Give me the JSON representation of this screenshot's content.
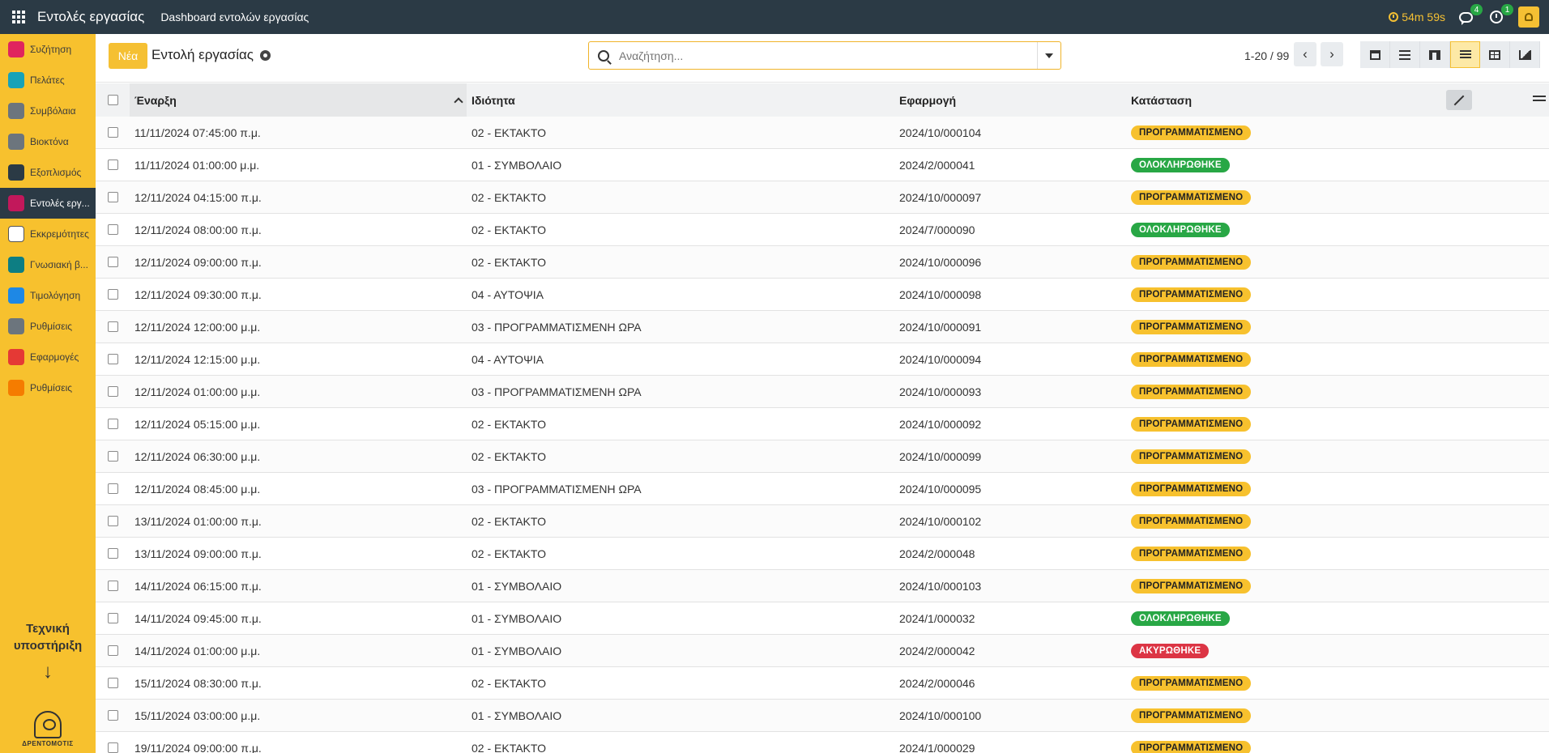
{
  "topbar": {
    "app_title": "Εντολές εργασίας",
    "menu_item": "Dashboard εντολών εργασίας",
    "timer": "54m 59s",
    "messages_count": "4",
    "activities_count": "1"
  },
  "sidebar": {
    "items": [
      {
        "label": "Συζήτηση",
        "icon": "chat-icon",
        "color": "#e0245e"
      },
      {
        "label": "Πελάτες",
        "icon": "customers-icon",
        "color": "#17a2b8"
      },
      {
        "label": "Συμβόλαια",
        "icon": "contracts-icon",
        "color": "#6c757d"
      },
      {
        "label": "Βιοκτόνα",
        "icon": "biocides-icon",
        "color": "#6c757d"
      },
      {
        "label": "Εξοπλισμός",
        "icon": "equipment-icon",
        "color": "#2b3a45"
      },
      {
        "label": "Εντολές εργ...",
        "icon": "work-orders-icon",
        "color": "#c2185b"
      },
      {
        "label": "Εκκρεμότητες",
        "icon": "tasks-icon",
        "color": "#ffffff"
      },
      {
        "label": "Γνωσιακή β...",
        "icon": "knowledge-icon",
        "color": "#0d7e83"
      },
      {
        "label": "Τιμολόγηση",
        "icon": "invoicing-icon",
        "color": "#1e88e5"
      },
      {
        "label": "Ρυθμίσεις",
        "icon": "settings-icon",
        "color": "#6c757d"
      },
      {
        "label": "Εφαρμογές",
        "icon": "apps-icon",
        "color": "#e53935"
      },
      {
        "label": "Ρυθμίσεις",
        "icon": "settings-alt-icon",
        "color": "#f57c00"
      }
    ],
    "active_index": 5,
    "support_line1": "Τεχνική",
    "support_line2": "υποστήριξη",
    "support_arrow": "↓",
    "logo_text": "ΔΡΕΝΤΟΜΟΤΙΣ"
  },
  "control": {
    "new_label": "Νέα",
    "title": "Εντολή εργασίας",
    "search_placeholder": "Αναζήτηση...",
    "pager": "1-20 / 99",
    "prev": "‹",
    "next": "›"
  },
  "table": {
    "headers": {
      "start": "Έναρξη",
      "priority": "Ιδιότητα",
      "application": "Εφαρμογή",
      "status": "Κατάσταση"
    },
    "rows": [
      {
        "start": "11/11/2024 07:45:00 π.μ.",
        "priority": "02 - ΕΚΤΑΚΤΟ",
        "application": "2024/10/000104",
        "status": "ΠΡΟΓΡΑΜΜΑΤΙΣΜΕΝΟ",
        "status_kind": "yellow"
      },
      {
        "start": "11/11/2024 01:00:00 μ.μ.",
        "priority": "01 - ΣΥΜΒΟΛΑΙΟ",
        "application": "2024/2/000041",
        "status": "ΟΛΟΚΛΗΡΩΘΗΚΕ",
        "status_kind": "green"
      },
      {
        "start": "12/11/2024 04:15:00 π.μ.",
        "priority": "02 - ΕΚΤΑΚΤΟ",
        "application": "2024/10/000097",
        "status": "ΠΡΟΓΡΑΜΜΑΤΙΣΜΕΝΟ",
        "status_kind": "yellow"
      },
      {
        "start": "12/11/2024 08:00:00 π.μ.",
        "priority": "02 - ΕΚΤΑΚΤΟ",
        "application": "2024/7/000090",
        "status": "ΟΛΟΚΛΗΡΩΘΗΚΕ",
        "status_kind": "green"
      },
      {
        "start": "12/11/2024 09:00:00 π.μ.",
        "priority": "02 - ΕΚΤΑΚΤΟ",
        "application": "2024/10/000096",
        "status": "ΠΡΟΓΡΑΜΜΑΤΙΣΜΕΝΟ",
        "status_kind": "yellow"
      },
      {
        "start": "12/11/2024 09:30:00 π.μ.",
        "priority": "04 - ΑΥΤΟΨΙΑ",
        "application": "2024/10/000098",
        "status": "ΠΡΟΓΡΑΜΜΑΤΙΣΜΕΝΟ",
        "status_kind": "yellow"
      },
      {
        "start": "12/11/2024 12:00:00 μ.μ.",
        "priority": "03 - ΠΡΟΓΡΑΜΜΑΤΙΣΜΕΝΗ ΩΡΑ",
        "application": "2024/10/000091",
        "status": "ΠΡΟΓΡΑΜΜΑΤΙΣΜΕΝΟ",
        "status_kind": "yellow"
      },
      {
        "start": "12/11/2024 12:15:00 μ.μ.",
        "priority": "04 - ΑΥΤΟΨΙΑ",
        "application": "2024/10/000094",
        "status": "ΠΡΟΓΡΑΜΜΑΤΙΣΜΕΝΟ",
        "status_kind": "yellow"
      },
      {
        "start": "12/11/2024 01:00:00 μ.μ.",
        "priority": "03 - ΠΡΟΓΡΑΜΜΑΤΙΣΜΕΝΗ ΩΡΑ",
        "application": "2024/10/000093",
        "status": "ΠΡΟΓΡΑΜΜΑΤΙΣΜΕΝΟ",
        "status_kind": "yellow"
      },
      {
        "start": "12/11/2024 05:15:00 μ.μ.",
        "priority": "02 - ΕΚΤΑΚΤΟ",
        "application": "2024/10/000092",
        "status": "ΠΡΟΓΡΑΜΜΑΤΙΣΜΕΝΟ",
        "status_kind": "yellow"
      },
      {
        "start": "12/11/2024 06:30:00 μ.μ.",
        "priority": "02 - ΕΚΤΑΚΤΟ",
        "application": "2024/10/000099",
        "status": "ΠΡΟΓΡΑΜΜΑΤΙΣΜΕΝΟ",
        "status_kind": "yellow"
      },
      {
        "start": "12/11/2024 08:45:00 μ.μ.",
        "priority": "03 - ΠΡΟΓΡΑΜΜΑΤΙΣΜΕΝΗ ΩΡΑ",
        "application": "2024/10/000095",
        "status": "ΠΡΟΓΡΑΜΜΑΤΙΣΜΕΝΟ",
        "status_kind": "yellow"
      },
      {
        "start": "13/11/2024 01:00:00 π.μ.",
        "priority": "02 - ΕΚΤΑΚΤΟ",
        "application": "2024/10/000102",
        "status": "ΠΡΟΓΡΑΜΜΑΤΙΣΜΕΝΟ",
        "status_kind": "yellow"
      },
      {
        "start": "13/11/2024 09:00:00 π.μ.",
        "priority": "02 - ΕΚΤΑΚΤΟ",
        "application": "2024/2/000048",
        "status": "ΠΡΟΓΡΑΜΜΑΤΙΣΜΕΝΟ",
        "status_kind": "yellow"
      },
      {
        "start": "14/11/2024 06:15:00 π.μ.",
        "priority": "01 - ΣΥΜΒΟΛΑΙΟ",
        "application": "2024/10/000103",
        "status": "ΠΡΟΓΡΑΜΜΑΤΙΣΜΕΝΟ",
        "status_kind": "yellow"
      },
      {
        "start": "14/11/2024 09:45:00 π.μ.",
        "priority": "01 - ΣΥΜΒΟΛΑΙΟ",
        "application": "2024/1/000032",
        "status": "ΟΛΟΚΛΗΡΩΘΗΚΕ",
        "status_kind": "green"
      },
      {
        "start": "14/11/2024 01:00:00 μ.μ.",
        "priority": "01 - ΣΥΜΒΟΛΑΙΟ",
        "application": "2024/2/000042",
        "status": "ΑΚΥΡΩΘΗΚΕ",
        "status_kind": "red"
      },
      {
        "start": "15/11/2024 08:30:00 π.μ.",
        "priority": "02 - ΕΚΤΑΚΤΟ",
        "application": "2024/2/000046",
        "status": "ΠΡΟΓΡΑΜΜΑΤΙΣΜΕΝΟ",
        "status_kind": "yellow"
      },
      {
        "start": "15/11/2024 03:00:00 μ.μ.",
        "priority": "01 - ΣΥΜΒΟΛΑΙΟ",
        "application": "2024/10/000100",
        "status": "ΠΡΟΓΡΑΜΜΑΤΙΣΜΕΝΟ",
        "status_kind": "yellow"
      },
      {
        "start": "19/11/2024 09:00:00 π.μ.",
        "priority": "02 - ΕΚΤΑΚΤΟ",
        "application": "2024/1/000029",
        "status": "ΠΡΟΓΡΑΜΜΑΤΙΣΜΕΝΟ",
        "status_kind": "yellow"
      }
    ]
  },
  "colors": {
    "topbar_bg": "#2b3a45",
    "sidebar_bg": "#f7c12e",
    "accent": "#f5c033",
    "status_green": "#28a745",
    "status_red": "#dc3545"
  }
}
